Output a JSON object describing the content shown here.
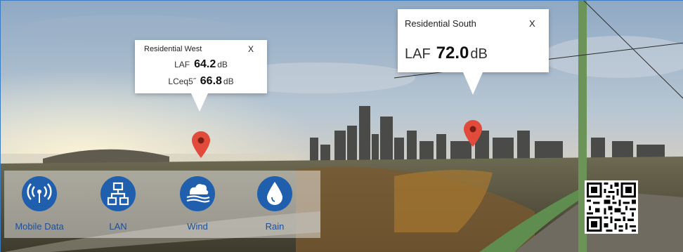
{
  "popups": {
    "west": {
      "title": "Residential West",
      "close": "X",
      "readings": [
        {
          "label": "LAF",
          "value": "64.2",
          "unit": "dB"
        },
        {
          "label": "LCeq5˝",
          "value": "66.8",
          "unit": "dB"
        }
      ]
    },
    "south": {
      "title": "Residential South",
      "close": "X",
      "readings": [
        {
          "label": "LAF",
          "value": "72.0",
          "unit": "dB"
        }
      ]
    }
  },
  "status": {
    "items": [
      {
        "label": "Mobile Data",
        "icon": "mobile-data-icon"
      },
      {
        "label": "LAN",
        "icon": "lan-icon"
      },
      {
        "label": "Wind",
        "icon": "wind-icon"
      },
      {
        "label": "Rain",
        "icon": "rain-icon"
      }
    ]
  },
  "colors": {
    "icon_circle": "#1f5fae",
    "label_text": "#1d4f9a",
    "pin": "#e24a3b"
  }
}
